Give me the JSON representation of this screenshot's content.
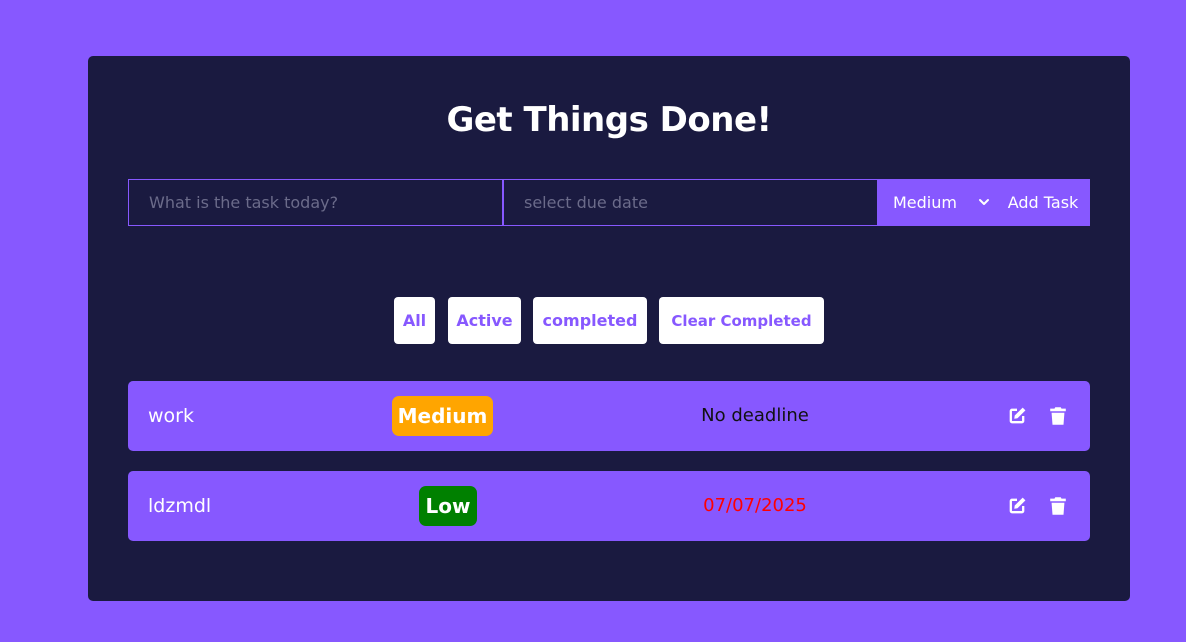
{
  "app": {
    "title": "Get Things Done!"
  },
  "form": {
    "task_placeholder": "What is the task today?",
    "date_placeholder": "select due date",
    "priority_selected": "Medium",
    "add_label": "Add Task"
  },
  "filters": [
    {
      "label": "All"
    },
    {
      "label": "Active"
    },
    {
      "label": "completed"
    },
    {
      "label": "Clear Completed"
    }
  ],
  "todos": [
    {
      "name": "work",
      "priority": "Medium",
      "priority_color": "#ffa500",
      "deadline": "No deadline",
      "deadline_color": "#111111"
    },
    {
      "name": "ldzmdl",
      "priority": "Low",
      "priority_color": "#008000",
      "deadline": "07/07/2025",
      "deadline_color": "#ff0000"
    }
  ],
  "icons": {
    "edit": "edit-icon",
    "delete": "trash-icon",
    "dropdown": "chevron-down-icon"
  },
  "colors": {
    "background": "#8758ff",
    "card": "#1a1a40",
    "accent": "#8758ff"
  }
}
